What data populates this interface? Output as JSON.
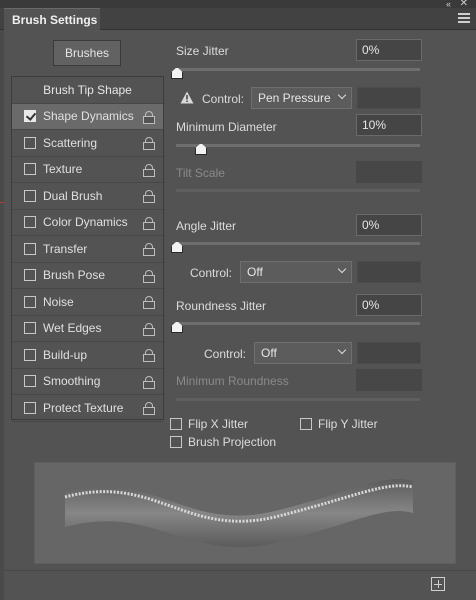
{
  "window": {
    "title": "Brush Settings"
  },
  "brushes_button": "Brushes",
  "list": {
    "header": "Brush Tip Shape",
    "items": [
      {
        "label": "Shape Dynamics",
        "checked": true,
        "selected": true
      },
      {
        "label": "Scattering",
        "checked": false
      },
      {
        "label": "Texture",
        "checked": false
      },
      {
        "label": "Dual Brush",
        "checked": false
      },
      {
        "label": "Color Dynamics",
        "checked": false
      },
      {
        "label": "Transfer",
        "checked": false
      },
      {
        "label": "Brush Pose",
        "checked": false
      },
      {
        "label": "Noise",
        "checked": false
      },
      {
        "label": "Wet Edges",
        "checked": false
      },
      {
        "label": "Build-up",
        "checked": false
      },
      {
        "label": "Smoothing",
        "checked": false
      },
      {
        "label": "Protect Texture",
        "checked": false
      }
    ]
  },
  "settings": {
    "size_jitter": {
      "label": "Size Jitter",
      "value": "0%",
      "level": 0
    },
    "control1": {
      "label": "Control:",
      "value": "Pen Pressure"
    },
    "min_diameter": {
      "label": "Minimum Diameter",
      "value": "10%",
      "level": 0.1
    },
    "tilt_scale": {
      "label": "Tilt Scale"
    },
    "angle_jitter": {
      "label": "Angle Jitter",
      "value": "0%",
      "level": 0
    },
    "control2": {
      "label": "Control:",
      "value": "Off"
    },
    "roundness_jitter": {
      "label": "Roundness Jitter",
      "value": "0%",
      "level": 0
    },
    "control3": {
      "label": "Control:",
      "value": "Off"
    },
    "min_roundness": {
      "label": "Minimum Roundness"
    },
    "flip_x": {
      "label": "Flip X Jitter",
      "checked": false
    },
    "flip_y": {
      "label": "Flip Y Jitter",
      "checked": false
    },
    "brush_projection": {
      "label": "Brush Projection",
      "checked": false
    }
  },
  "icons": {
    "lock": "lock-icon",
    "warning": "warning-icon",
    "new": "new-preset-icon",
    "menu": "panel-menu-icon",
    "collapse": "collapse-icon",
    "close": "close-icon"
  }
}
